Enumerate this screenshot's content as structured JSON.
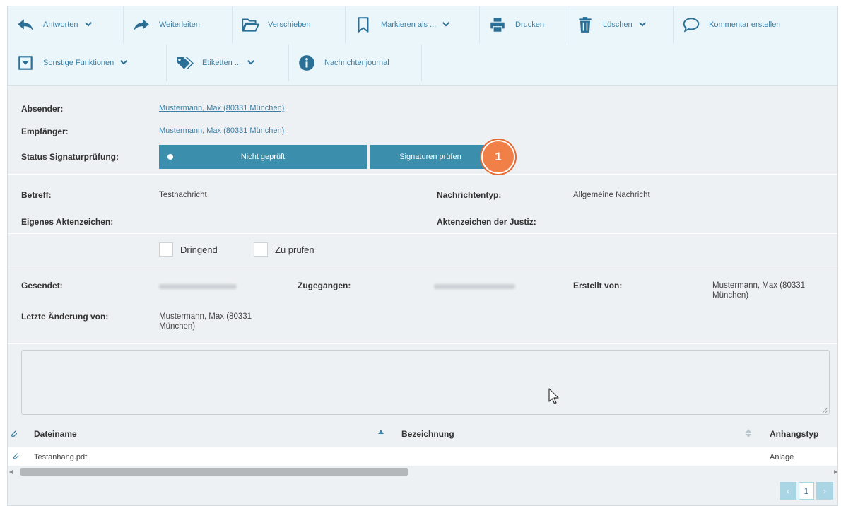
{
  "toolbar": {
    "reply": "Antworten",
    "forward": "Weiterleiten",
    "move": "Verschieben",
    "mark": "Markieren als ...",
    "print": "Drucken",
    "delete": "Löschen",
    "comment": "Kommentar erstellen",
    "more": "Sonstige Funktionen",
    "labels": "Etiketten ...",
    "journal": "Nachrichtenjournal"
  },
  "header": {
    "sender_label": "Absender:",
    "sender_value": "Mustermann, Max (80331 München)",
    "recipient_label": "Empfänger:",
    "recipient_value": "Mustermann, Max (80331 München)",
    "status_label": "Status Signaturprüfung:",
    "status_value": "Nicht geprüft",
    "check_button": "Signaturen prüfen",
    "badge": "1"
  },
  "details": {
    "subject_label": "Betreff:",
    "subject_value": "Testnachricht",
    "type_label": "Nachrichtentyp:",
    "type_value": "Allgemeine Nachricht",
    "own_ref_label": "Eigenes Aktenzeichen:",
    "court_ref_label": "Aktenzeichen der Justiz:"
  },
  "flags": {
    "urgent": "Dringend",
    "to_check": "Zu prüfen"
  },
  "meta": {
    "sent_label": "Gesendet:",
    "received_label": "Zugegangen:",
    "created_by_label": "Erstellt von:",
    "created_by_value": "Mustermann, Max (80331 München)",
    "last_change_label": "Letzte Änderung von:",
    "last_change_value": "Mustermann, Max (80331 München)"
  },
  "attachments": {
    "columns": [
      "Dateiname",
      "Bezeichnung",
      "Anhangstyp"
    ],
    "rows": [
      {
        "filename": "Testanhang.pdf",
        "description": "",
        "type": "Anlage"
      }
    ]
  },
  "pager": {
    "prev": "‹",
    "page": "1",
    "next": "›"
  },
  "colors": {
    "accent": "#3b8fad",
    "link": "#3a7fa5",
    "badge": "#f08048",
    "toolbar_bg": "#ebf6fa",
    "panel_bg": "#eef1f3"
  }
}
